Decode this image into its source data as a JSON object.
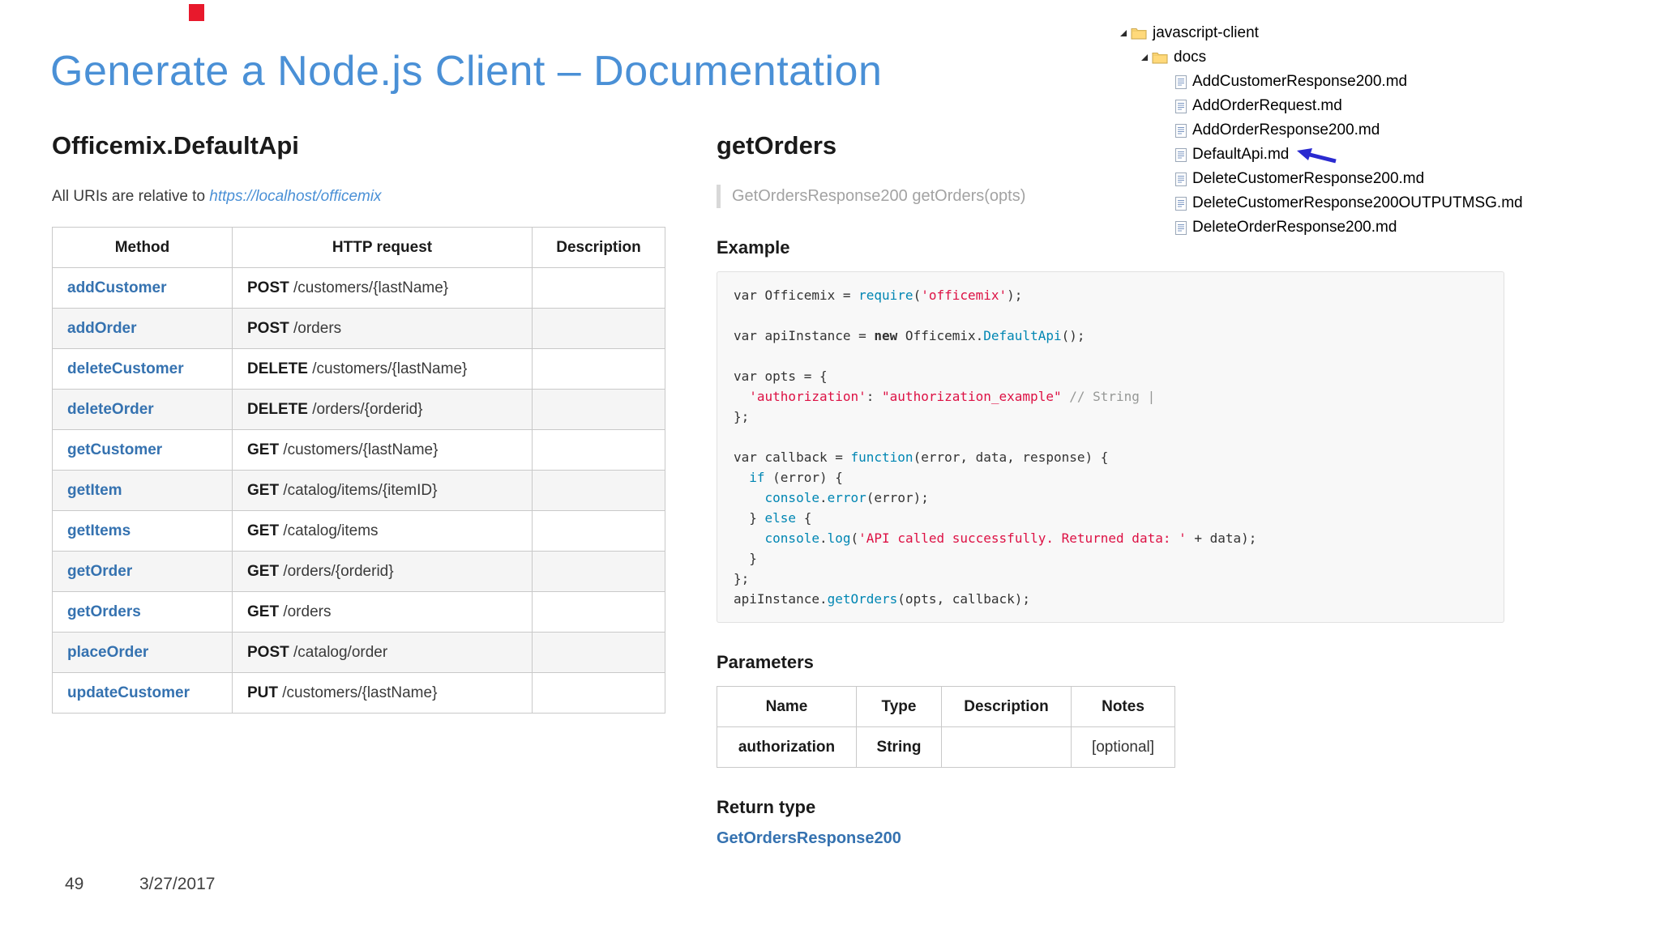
{
  "slide": {
    "title": "Generate a Node.js Client – Documentation",
    "page_number": "49",
    "date": "3/27/2017"
  },
  "colors": {
    "title_blue": "#4a90d6",
    "link_blue": "#3572b0",
    "string_red": "#dd1144",
    "function_blue": "#0086b3",
    "comment_gray": "#969896",
    "arrow_blue": "#2a2ad0",
    "marker_red": "#e8192c"
  },
  "left": {
    "heading": "Officemix.DefaultApi",
    "base_uri_prefix": "All URIs are relative to ",
    "base_uri_link": "https://localhost/officemix",
    "table": {
      "headers": [
        "Method",
        "HTTP request",
        "Description"
      ],
      "rows": [
        {
          "method": "addCustomer",
          "verb": "POST",
          "path": "/customers/{lastName}",
          "description": ""
        },
        {
          "method": "addOrder",
          "verb": "POST",
          "path": "/orders",
          "description": ""
        },
        {
          "method": "deleteCustomer",
          "verb": "DELETE",
          "path": "/customers/{lastName}",
          "description": ""
        },
        {
          "method": "deleteOrder",
          "verb": "DELETE",
          "path": "/orders/{orderid}",
          "description": ""
        },
        {
          "method": "getCustomer",
          "verb": "GET",
          "path": "/customers/{lastName}",
          "description": ""
        },
        {
          "method": "getItem",
          "verb": "GET",
          "path": "/catalog/items/{itemID}",
          "description": ""
        },
        {
          "method": "getItems",
          "verb": "GET",
          "path": "/catalog/items",
          "description": ""
        },
        {
          "method": "getOrder",
          "verb": "GET",
          "path": "/orders/{orderid}",
          "description": ""
        },
        {
          "method": "getOrders",
          "verb": "GET",
          "path": "/orders",
          "description": ""
        },
        {
          "method": "placeOrder",
          "verb": "POST",
          "path": "/catalog/order",
          "description": ""
        },
        {
          "method": "updateCustomer",
          "verb": "PUT",
          "path": "/customers/{lastName}",
          "description": ""
        }
      ]
    }
  },
  "right": {
    "heading": "getOrders",
    "signature": "GetOrdersResponse200 getOrders(opts)",
    "example_heading": "Example",
    "code_lines": [
      [
        [
          "p",
          "var Officemix = "
        ],
        [
          "kw",
          "require"
        ],
        [
          "p",
          "("
        ],
        [
          "s",
          "'officemix'"
        ],
        [
          "p",
          ");"
        ]
      ],
      [],
      [
        [
          "p",
          "var apiInstance = "
        ],
        [
          "k",
          "new"
        ],
        [
          "p",
          " Officemix."
        ],
        [
          "fn",
          "DefaultApi"
        ],
        [
          "p",
          "();"
        ]
      ],
      [],
      [
        [
          "p",
          "var opts = { "
        ]
      ],
      [
        [
          "p",
          "  "
        ],
        [
          "s",
          "'authorization'"
        ],
        [
          "p",
          ": "
        ],
        [
          "s",
          "\"authorization_example\""
        ],
        [
          "p",
          " "
        ],
        [
          "c",
          "// String | "
        ]
      ],
      [
        [
          "p",
          "};"
        ]
      ],
      [],
      [
        [
          "p",
          "var callback = "
        ],
        [
          "kw",
          "function"
        ],
        [
          "p",
          "(error, data, response) {"
        ]
      ],
      [
        [
          "p",
          "  "
        ],
        [
          "kw",
          "if"
        ],
        [
          "p",
          " (error) {"
        ]
      ],
      [
        [
          "p",
          "    "
        ],
        [
          "fn",
          "console"
        ],
        [
          "p",
          "."
        ],
        [
          "fn",
          "error"
        ],
        [
          "p",
          "(error);"
        ]
      ],
      [
        [
          "p",
          "  } "
        ],
        [
          "kw",
          "else"
        ],
        [
          "p",
          " {"
        ]
      ],
      [
        [
          "p",
          "    "
        ],
        [
          "fn",
          "console"
        ],
        [
          "p",
          "."
        ],
        [
          "fn",
          "log"
        ],
        [
          "p",
          "("
        ],
        [
          "s",
          "'API called successfully. Returned data: '"
        ],
        [
          "p",
          " + data);"
        ]
      ],
      [
        [
          "p",
          "  }"
        ]
      ],
      [
        [
          "p",
          "};"
        ]
      ],
      [
        [
          "p",
          "apiInstance."
        ],
        [
          "fn",
          "getOrders"
        ],
        [
          "p",
          "(opts, callback);"
        ]
      ]
    ],
    "parameters_heading": "Parameters",
    "params_table": {
      "headers": [
        "Name",
        "Type",
        "Description",
        "Notes"
      ],
      "rows": [
        {
          "name": "authorization",
          "type": "String",
          "description": "",
          "notes": "[optional]"
        }
      ]
    },
    "return_type_heading": "Return type",
    "return_type_link": "GetOrdersResponse200"
  },
  "file_tree": {
    "items": [
      {
        "label": "javascript-client",
        "type": "folder",
        "level": 0,
        "expanded": true
      },
      {
        "label": "docs",
        "type": "folder",
        "level": 1,
        "expanded": true
      },
      {
        "label": "AddCustomerResponse200.md",
        "type": "file",
        "level": 2
      },
      {
        "label": "AddOrderRequest.md",
        "type": "file",
        "level": 2
      },
      {
        "label": "AddOrderResponse200.md",
        "type": "file",
        "level": 2
      },
      {
        "label": "DefaultApi.md",
        "type": "file",
        "level": 2,
        "highlighted": true
      },
      {
        "label": "DeleteCustomerResponse200.md",
        "type": "file",
        "level": 2
      },
      {
        "label": "DeleteCustomerResponse200OUTPUTMSG.md",
        "type": "file",
        "level": 2
      },
      {
        "label": "DeleteOrderResponse200.md",
        "type": "file",
        "level": 2
      }
    ]
  }
}
